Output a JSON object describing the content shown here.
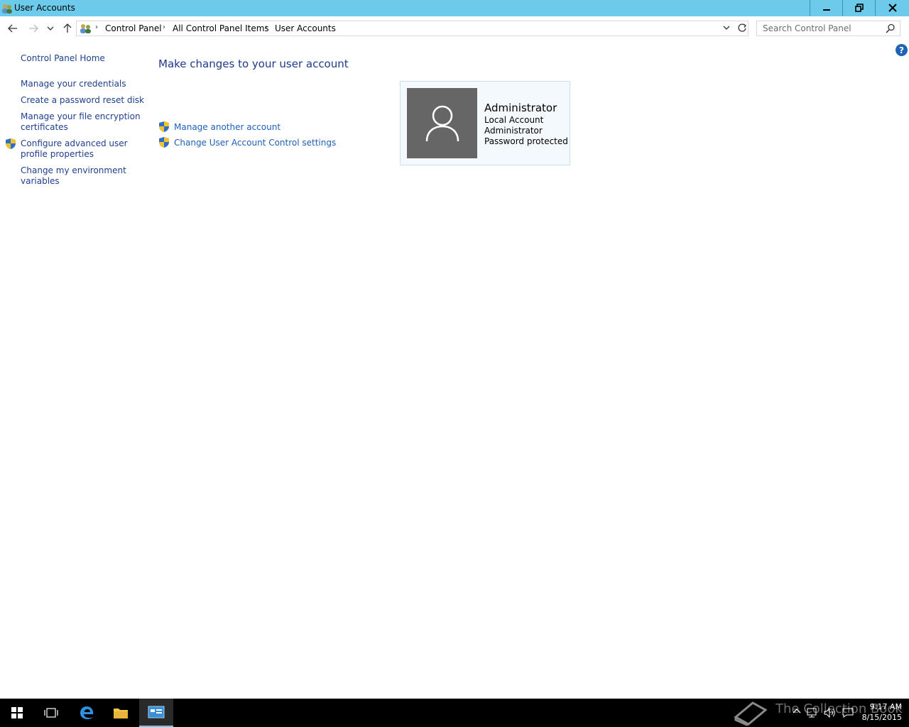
{
  "window": {
    "title": "User Accounts"
  },
  "breadcrumb": [
    "Control Panel",
    "All Control Panel Items",
    "User Accounts"
  ],
  "search": {
    "placeholder": "Search Control Panel"
  },
  "sidebar": {
    "home": "Control Panel Home",
    "links": [
      {
        "label": "Manage your credentials"
      },
      {
        "label": "Create a password reset disk"
      },
      {
        "label": "Manage your file encryption certificates",
        "line1": "Manage your file encryption",
        "line2": "certificates"
      },
      {
        "label": "Configure advanced user profile properties",
        "line1": "Configure advanced user",
        "line2": "profile properties",
        "shield": true
      },
      {
        "label": "Change my environment variables",
        "line1": "Change my environment",
        "line2": "variables"
      }
    ]
  },
  "main": {
    "heading": "Make changes to your user account",
    "links": [
      "Manage another account",
      "Change User Account Control settings"
    ]
  },
  "account": {
    "name": "Administrator",
    "details": [
      "Local Account",
      "Administrator",
      "Password protected"
    ]
  },
  "taskbar": {
    "watermark": "The Collection Book",
    "time": "9:17 AM",
    "date": "8/15/2015"
  },
  "colors": {
    "titlebar": "#6ccaea",
    "link": "#1f5fb8",
    "heading": "#1e3a8a",
    "avatar": "#666666",
    "taskbar": "#000000"
  }
}
